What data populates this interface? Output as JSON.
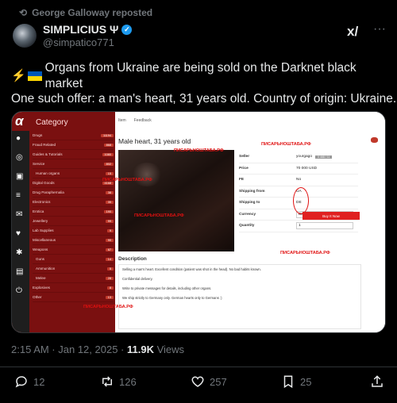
{
  "repost": {
    "label": "George Galloway reposted"
  },
  "author": {
    "name": "SIMPLICIUS Ψ",
    "handle": "@simpatico771"
  },
  "tweet": {
    "line1": "Organs from Ukraine are being sold on the Darknet black market",
    "line2": "One such offer: a man's heart, 31 years old. Country of origin: Ukraine."
  },
  "embedded": {
    "logo": "α",
    "category_title": "Category",
    "categories": [
      {
        "label": "Drugs",
        "count": "11194"
      },
      {
        "label": "Fraud Related",
        "count": "868"
      },
      {
        "label": "Guides & Tutorials",
        "count": "1080"
      },
      {
        "label": "Service",
        "count": "802"
      },
      {
        "label": "Human organs",
        "count": "15"
      },
      {
        "label": "Digital Goods",
        "count": "4168"
      },
      {
        "label": "Drug Paraphernalia",
        "count": "38"
      },
      {
        "label": "Electronics",
        "count": "35"
      },
      {
        "label": "Erotica",
        "count": "190"
      },
      {
        "label": "Jewellery",
        "count": "99"
      },
      {
        "label": "Lab Supplies",
        "count": "9"
      },
      {
        "label": "Miscellaneous",
        "count": "90"
      },
      {
        "label": "Weapons",
        "count": "67"
      },
      {
        "label": "Guns",
        "count": "14"
      },
      {
        "label": "Ammunition",
        "count": "5"
      },
      {
        "label": "Melee",
        "count": "28"
      },
      {
        "label": "Explosives",
        "count": "8"
      },
      {
        "label": "Other",
        "count": "13"
      }
    ],
    "tabs": [
      "Item",
      "Feedback"
    ],
    "product_title": "Male heart, 31 years old",
    "watermark": "ПИСАРЬНОШТАБА.РФ",
    "info": [
      {
        "key": "Seller",
        "value": "yourgago",
        "tag": "0 468 / 11"
      },
      {
        "key": "Price",
        "value": "70 000  USD"
      },
      {
        "key": "FE",
        "value": "No"
      },
      {
        "key": "Shipping from",
        "value": "UA"
      },
      {
        "key": "Shipping to",
        "value": "DE"
      },
      {
        "key": "Currency",
        "value": "Bitcoin"
      },
      {
        "key": "Quantity",
        "value": "1"
      }
    ],
    "buy_label": "Buy It Now",
    "description_title": "Description",
    "description": [
      "Selling a man's heart. Excellent condition (patient was shot in the head). No bad habits known.",
      "Confidential delivery.",
      "Write to private messages for details, including other organs.",
      "We ship strictly to Germany only. German hearts only to Germans :)"
    ]
  },
  "meta": {
    "time": "2:15 AM · Jan 12, 2025 · ",
    "views": "11.9K",
    "views_label": " Views"
  },
  "actions": {
    "replies": "12",
    "reposts": "126",
    "likes": "257",
    "bookmarks": "25"
  }
}
